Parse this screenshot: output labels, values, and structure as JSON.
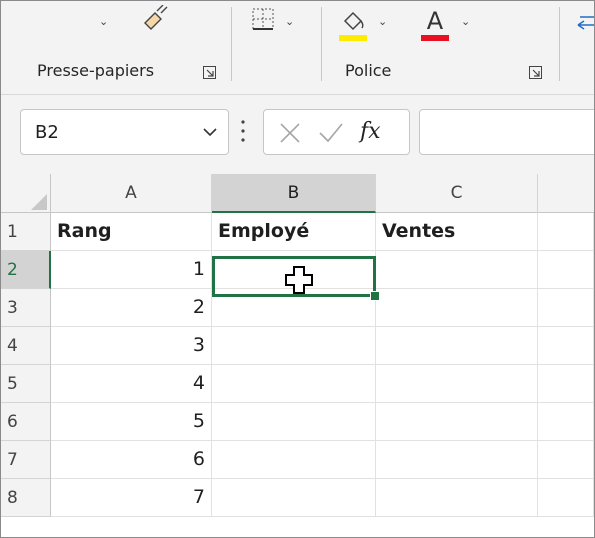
{
  "ribbon": {
    "groups": [
      {
        "label": "Presse-papiers"
      },
      {
        "label": "Police"
      }
    ],
    "font_color": "#e81123",
    "highlight_color": "#ffeb00"
  },
  "formula_bar": {
    "name_box": "B2",
    "fx_label": "fx",
    "formula_value": ""
  },
  "sheet": {
    "columns": [
      "A",
      "B",
      "C"
    ],
    "rows": [
      "1",
      "2",
      "3",
      "4",
      "5",
      "6",
      "7",
      "8"
    ],
    "selected_cell": "B2",
    "cells": {
      "A1": "Rang",
      "B1": "Employé",
      "C1": "Ventes",
      "A2": "1",
      "A3": "2",
      "A4": "3",
      "A5": "4",
      "A6": "5",
      "A7": "6",
      "A8": "7"
    },
    "accent": "#217346"
  }
}
